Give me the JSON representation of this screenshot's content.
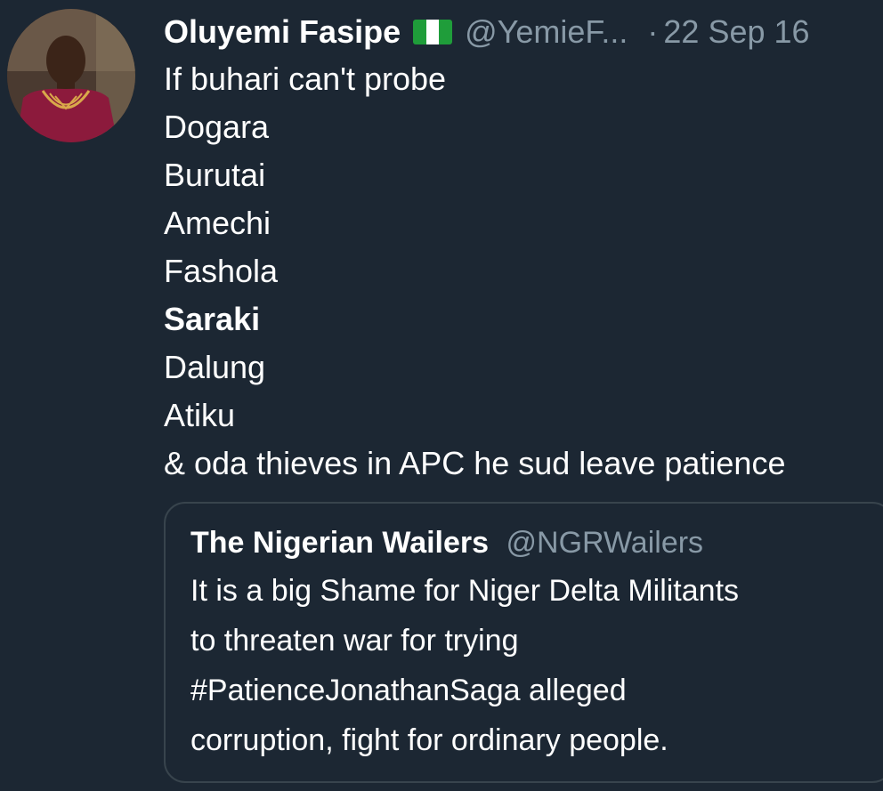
{
  "tweet": {
    "author_name": "Oluyemi Fasipe",
    "author_handle": "@YemieF...",
    "separator": "·",
    "date": "22 Sep 16",
    "avatar_icon": "profile-photo",
    "flag_icon": "nigeria-flag-icon",
    "lines": [
      "If buhari can't probe",
      "Dogara",
      "Burutai",
      "Amechi",
      "Fashola",
      "Saraki",
      "Dalung",
      "Atiku",
      "& oda thieves in APC he sud leave patience"
    ]
  },
  "quoted_tweet": {
    "author_name": "The Nigerian Wailers",
    "author_handle": "@NGRWailers",
    "lines": [
      "It is a big Shame for Niger Delta Militants",
      "to threaten war for trying",
      "#PatienceJonathanSaga alleged",
      "corruption, fight for ordinary people."
    ]
  },
  "colors": {
    "background": "#1c2733",
    "text": "#ffffff",
    "secondary_text": "#8899a6",
    "border": "#38444d"
  }
}
